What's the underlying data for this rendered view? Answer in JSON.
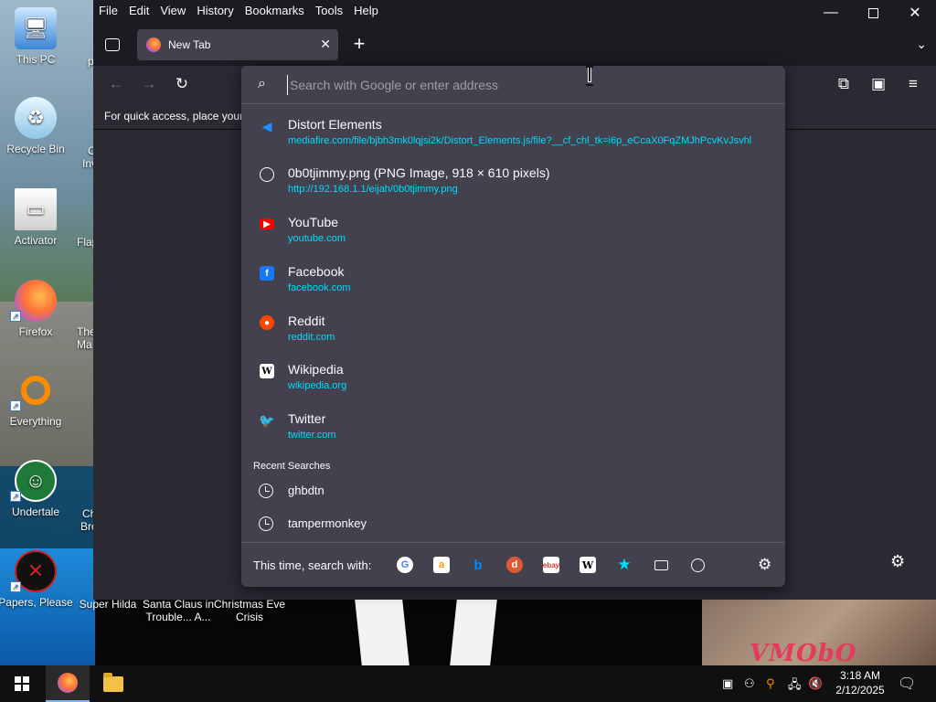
{
  "desktop": {
    "icons": [
      {
        "label": "This PC"
      },
      {
        "label": "Recycle Bin"
      },
      {
        "label": "Activator"
      },
      {
        "label": "Firefox"
      },
      {
        "label": "Everything"
      },
      {
        "label": "Undertale"
      },
      {
        "label": "Papers, Please"
      }
    ],
    "partial_labels": {
      "p": "p",
      "c1": "C",
      "inv": "Inv",
      "flap": "Flap",
      "the": "The",
      "ma": "Ma",
      "ch": "Ch",
      "bro": "Bro"
    },
    "bottom_labels": {
      "super_hilda": "Super Hilda",
      "santa_line1": "Santa Claus in",
      "santa_line2": "Trouble... A...",
      "christmas_line1": "Christmas Eve",
      "christmas_line2": "Crisis"
    },
    "wallpaper_text": "VMObO"
  },
  "firefox": {
    "menu": [
      "File",
      "Edit",
      "View",
      "History",
      "Bookmarks",
      "Tools",
      "Help"
    ],
    "tab": {
      "title": "New Tab"
    },
    "bookmarks_toolbar_text": "For quick access, place your",
    "urlbar": {
      "placeholder": "Search with Google or enter address",
      "value": ""
    },
    "results": [
      {
        "title": "Distort Elements",
        "url": "mediafire.com/file/bjbh3mk0lqjsi2k/Distort_Elements.js/file?__cf_chl_tk=i6p_eCcaX0FqZMJhPcvKvJsvhl",
        "icon": "mediafire-icon",
        "color": "#1e90ff"
      },
      {
        "title": "0b0tjimmy.png (PNG Image, 918 × 610 pixels)",
        "url": "http://192.168.1.1/eijah/0b0tjimmy.png",
        "icon": "globe-icon",
        "color": "#fbfbfe"
      },
      {
        "title": "YouTube",
        "url": "youtube.com",
        "icon": "youtube-icon",
        "color": "#ff0000"
      },
      {
        "title": "Facebook",
        "url": "facebook.com",
        "icon": "facebook-icon",
        "color": "#1877f2"
      },
      {
        "title": "Reddit",
        "url": "reddit.com",
        "icon": "reddit-icon",
        "color": "#ff4500"
      },
      {
        "title": "Wikipedia",
        "url": "wikipedia.org",
        "icon": "wikipedia-icon",
        "color": "#ffffff"
      },
      {
        "title": "Twitter",
        "url": "twitter.com",
        "icon": "twitter-icon",
        "color": "#1da1f2"
      }
    ],
    "recent_header": "Recent Searches",
    "recent_searches": [
      "ghbdtn",
      "tampermonkey"
    ],
    "footer_label": "This time, search with:",
    "engines": [
      "google-icon",
      "amazon-icon",
      "bing-icon",
      "duckduckgo-icon",
      "ebay-icon",
      "wikipedia-icon",
      "bookmarks-star-icon",
      "tabs-icon",
      "history-clock-icon"
    ]
  },
  "taskbar": {
    "time": "3:18 AM",
    "date": "2/12/2025"
  }
}
